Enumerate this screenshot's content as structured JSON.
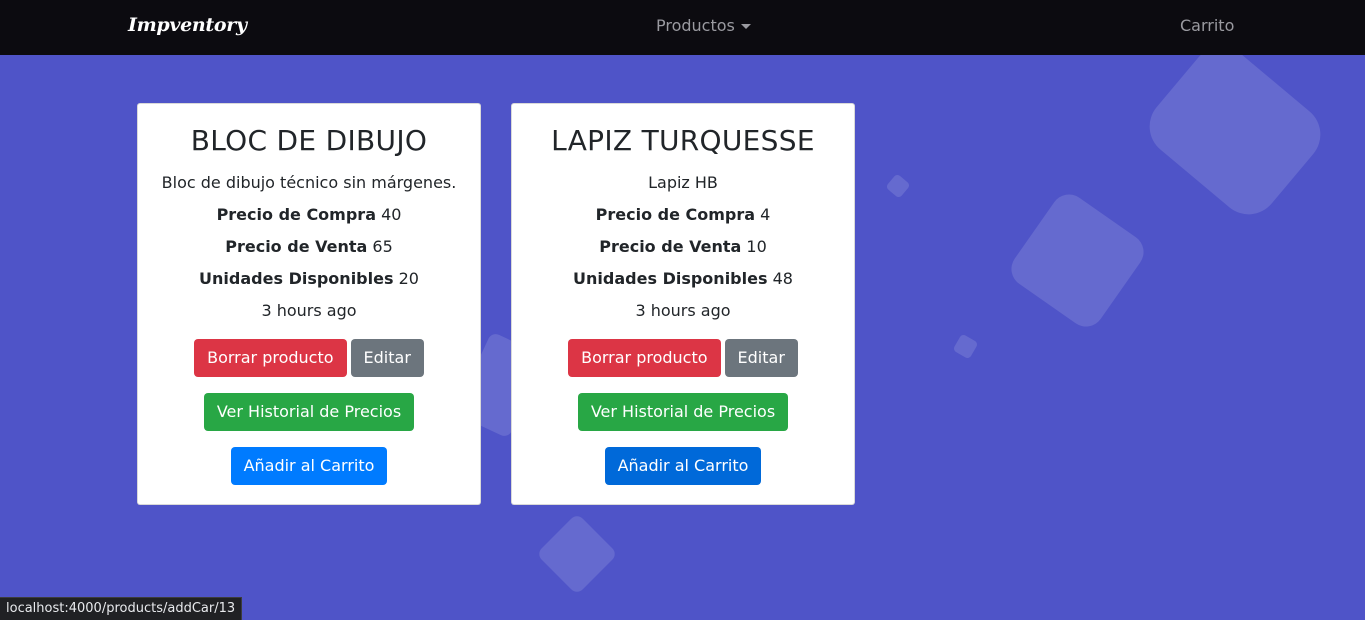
{
  "navbar": {
    "brand": "Impventory",
    "products_label": "Productos",
    "cart_label": "Carrito"
  },
  "products": [
    {
      "name": "BLOC DE DIBUJO",
      "description": "Bloc de dibujo técnico sin márgenes.",
      "buy_label": "Precio de Compra",
      "buy_price": "40",
      "sell_label": "Precio de Venta",
      "sell_price": "65",
      "units_label": "Unidades Disponibles",
      "units": "20",
      "time": "3 hours ago",
      "delete_label": "Borrar producto",
      "edit_label": "Editar",
      "history_label": "Ver Historial de Precios",
      "add_cart_label": "Añadir al Carrito"
    },
    {
      "name": "LAPIZ TURQUESSE",
      "description": "Lapiz HB",
      "buy_label": "Precio de Compra",
      "buy_price": "4",
      "sell_label": "Precio de Venta",
      "sell_price": "10",
      "units_label": "Unidades Disponibles",
      "units": "48",
      "time": "3 hours ago",
      "delete_label": "Borrar producto",
      "edit_label": "Editar",
      "history_label": "Ver Historial de Precios",
      "add_cart_label": "Añadir al Carrito"
    }
  ],
  "status_bar": {
    "url": "localhost:4000/products/addCar/13"
  },
  "colors": {
    "background": "#4f54c8",
    "navbar": "#0c0b10",
    "danger": "#dc3545",
    "secondary": "#6c757d",
    "success": "#28a745",
    "primary": "#007bff"
  },
  "icons": {
    "dropdown": "chevron-down-icon"
  }
}
